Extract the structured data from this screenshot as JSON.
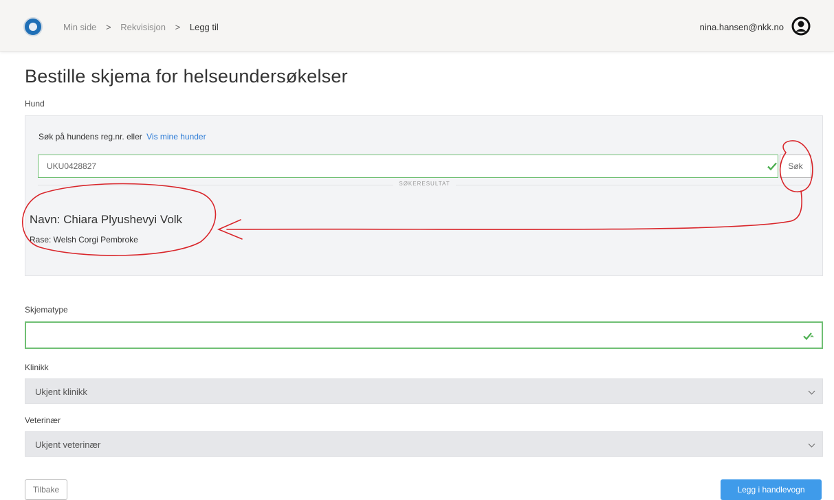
{
  "navbar": {
    "logo": "nkk-logo",
    "breadcrumb": [
      "Min side",
      "Rekvisisjon",
      "Legg til"
    ],
    "breadcrumb_separator": ">",
    "user_email": "nina.hansen@nkk.no",
    "user_icon": "user-circle-icon"
  },
  "page": {
    "title": "Bestille skjema for helseundersøkelser"
  },
  "dog": {
    "label": "Hund",
    "search_hint": "Søk på hundens reg.nr. eller",
    "search_link": "Vis mine hunder",
    "search_value": "UKU0428827",
    "search_button": "Søk",
    "results_heading": "SØKERESULTAT",
    "result_name": "Navn: Chiara Plyushevyi Volk",
    "result_breed": "Rase: Welsh Corgi Pembroke"
  },
  "form": {
    "schema_label": "Skjematype",
    "schema_value": "",
    "clinic_label": "Klinikk",
    "clinic_value": "Ukjent klinikk",
    "vet_label": "Veterinær",
    "vet_value": "Ukjent veterinær"
  },
  "actions": {
    "back": "Tilbake",
    "add_to_cart": "Legg i handlevogn"
  },
  "colors": {
    "accent": "#3f9bea",
    "valid": "#4caf50",
    "annotation": "#d9262b",
    "link": "#2a7ad6"
  }
}
